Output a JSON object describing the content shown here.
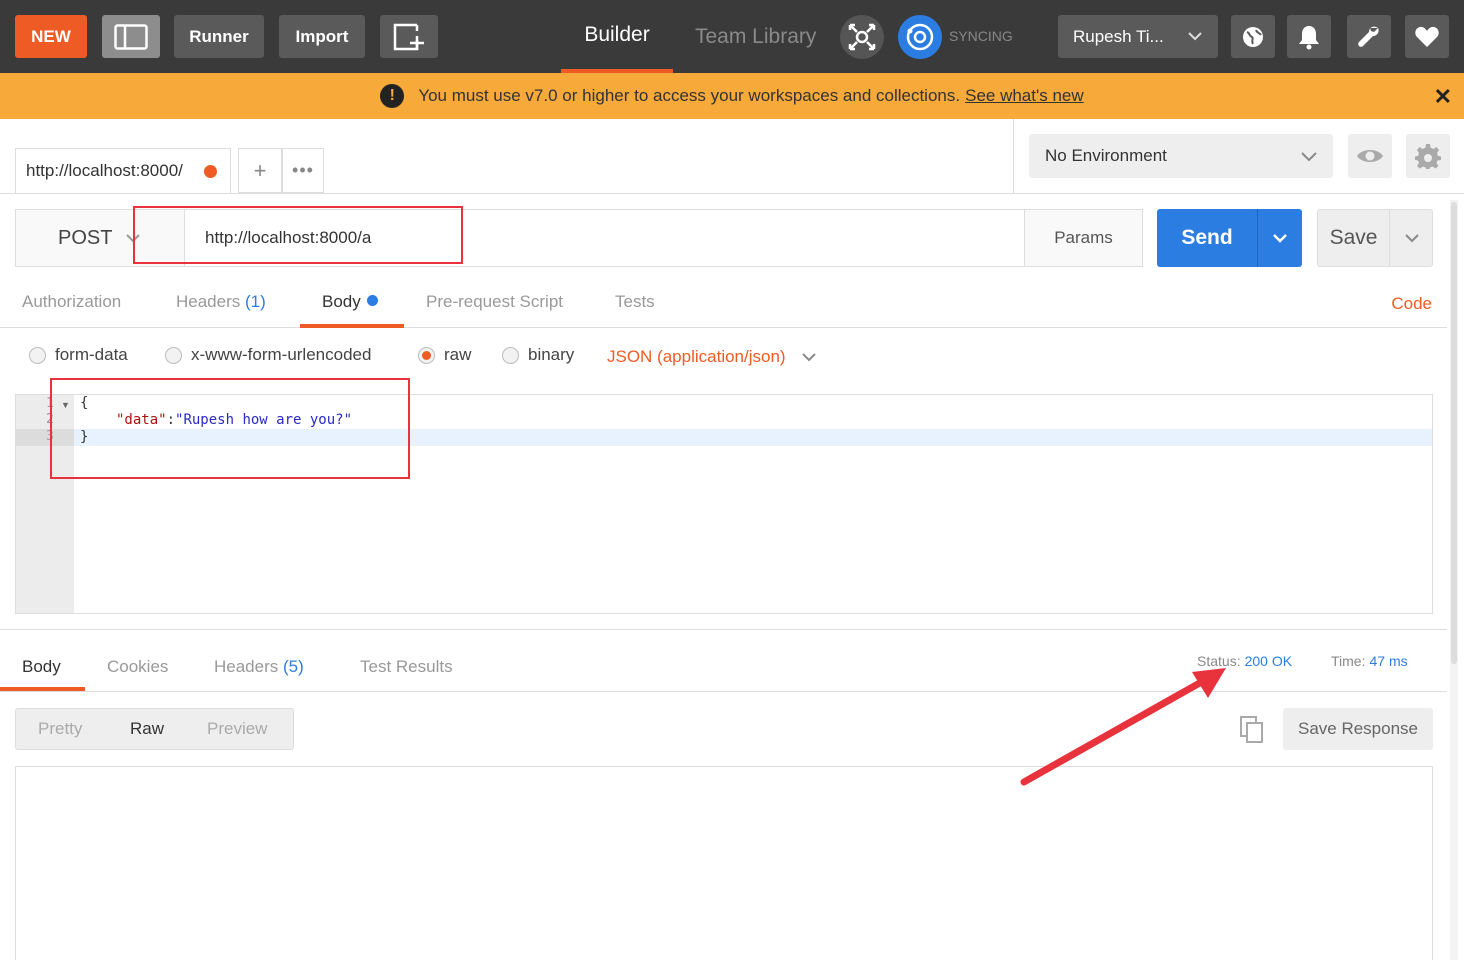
{
  "toolbar": {
    "new_label": "NEW",
    "runner_label": "Runner",
    "import_label": "Import",
    "builder_tab": "Builder",
    "team_library_tab": "Team Library",
    "sync_status": "SYNCING",
    "user_name": "Rupesh Ti...",
    "accent_color": "#ef5b25"
  },
  "banner": {
    "message": "You must use v7.0 or higher to access your workspaces and collections.",
    "link": "See what's new",
    "color": "#f7a93a"
  },
  "request_tab": {
    "title": "http://localhost:8000/",
    "add_label": "+",
    "more_label": "•••"
  },
  "environment": {
    "selected": "No Environment"
  },
  "request": {
    "method": "POST",
    "url": "http://localhost:8000/a",
    "params_label": "Params",
    "send_label": "Send",
    "save_label": "Save",
    "send_color": "#2b7de1"
  },
  "request_tabs": {
    "authorization": "Authorization",
    "headers": "Headers",
    "headers_count": "(1)",
    "body": "Body",
    "prerequest": "Pre-request Script",
    "tests": "Tests",
    "code": "Code"
  },
  "body_types": {
    "form_data": "form-data",
    "urlencoded": "x-www-form-urlencoded",
    "raw": "raw",
    "binary": "binary",
    "content_type": "JSON (application/json)",
    "selected": "raw"
  },
  "editor": {
    "line_numbers": [
      "1",
      "2",
      "3"
    ],
    "line1": "{",
    "key": "\"data\"",
    "colon": ":",
    "value": "\"Rupesh how are you?\"",
    "line3": "}"
  },
  "response_tabs": {
    "body": "Body",
    "cookies": "Cookies",
    "headers": "Headers",
    "headers_count": "(5)",
    "test_results": "Test Results",
    "status_label": "Status:",
    "status_value": "200 OK",
    "time_label": "Time:",
    "time_value": "47 ms"
  },
  "response_view": {
    "pretty": "Pretty",
    "raw": "Raw",
    "preview": "Preview",
    "selected": "Raw",
    "save_response": "Save Response"
  },
  "icons": {
    "layout": "sidebar-toggle-icon",
    "new_window": "new-window-icon",
    "interceptor": "interceptor-icon",
    "sync": "sync-icon",
    "user_dropdown": "chevron-down-icon",
    "globe": "globe-icon",
    "bell": "bell-icon",
    "wrench": "wrench-icon",
    "heart": "heart-icon",
    "warning": "warning-icon",
    "close": "close-icon",
    "eye": "eye-icon",
    "gear": "gear-icon",
    "copy": "copy-icon"
  }
}
